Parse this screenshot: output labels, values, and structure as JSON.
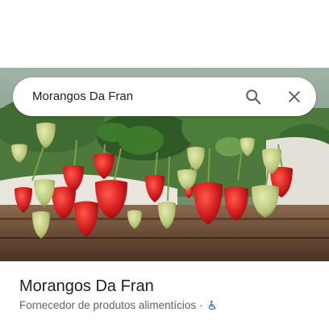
{
  "search": {
    "query": "Morangos Da Fran",
    "search_icon": "search-icon",
    "close_icon": "close-icon"
  },
  "photo": {
    "subject": "strawberry-plants-photo"
  },
  "place": {
    "name": "Morangos Da Fran",
    "category": "Fornecedor de produtos alimentícios",
    "separator": "·",
    "accessibility_icon": "wheelchair-accessible-icon",
    "accessibility_color": "#1a73e8"
  }
}
